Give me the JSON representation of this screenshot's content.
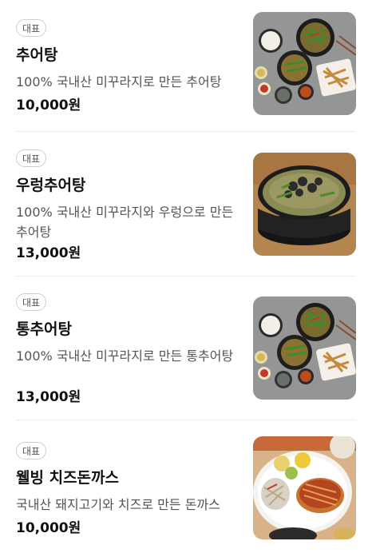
{
  "menu": {
    "items": [
      {
        "badge": "대표",
        "name": "추어탕",
        "description": "100% 국내산 미꾸라지로 만든 추어탕",
        "price": "10,000원",
        "image": "chueotang-set-image"
      },
      {
        "badge": "대표",
        "name": "우렁추어탕",
        "description": "100% 국내산 미꾸라지와 우렁으로 만든 추어탕",
        "price": "13,000원",
        "image": "ureong-chueotang-image"
      },
      {
        "badge": "대표",
        "name": "통추어탕",
        "description": "100% 국내산 미꾸라지로 만든 통추어탕",
        "price": "13,000원",
        "image": "tong-chueotang-set-image"
      },
      {
        "badge": "대표",
        "name": "웰빙 치즈돈까스",
        "description": "국내산 돼지고기와 치즈로 만든 돈까스",
        "price": "10,000원",
        "image": "cheese-donkatsu-image"
      }
    ]
  }
}
